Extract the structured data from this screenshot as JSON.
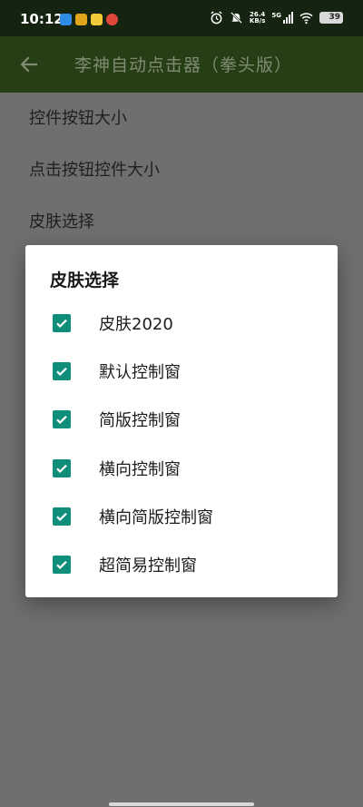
{
  "status_bar": {
    "time": "10:12",
    "net_speed_value": "26.4",
    "net_speed_unit": "KB/s",
    "signal_type": "5G",
    "battery": "39"
  },
  "toolbar": {
    "title": "李神自动点击器（拳头版）",
    "back_icon": "arrow-left-icon"
  },
  "settings": [
    {
      "label": "控件按钮大小"
    },
    {
      "label": "点击按钮控件大小"
    },
    {
      "label": "皮肤选择"
    }
  ],
  "dialog": {
    "title": "皮肤选择",
    "options": [
      {
        "label": "皮肤2020",
        "checked": true
      },
      {
        "label": "默认控制窗",
        "checked": true
      },
      {
        "label": "简版控制窗",
        "checked": true
      },
      {
        "label": "横向控制窗",
        "checked": true
      },
      {
        "label": "横向简版控制窗",
        "checked": true
      },
      {
        "label": "超简易控制窗",
        "checked": true
      }
    ]
  },
  "colors": {
    "toolbar": "#253e16",
    "checkbox": "#0f8f7a",
    "dim_overlay": "#6f6f6f"
  }
}
